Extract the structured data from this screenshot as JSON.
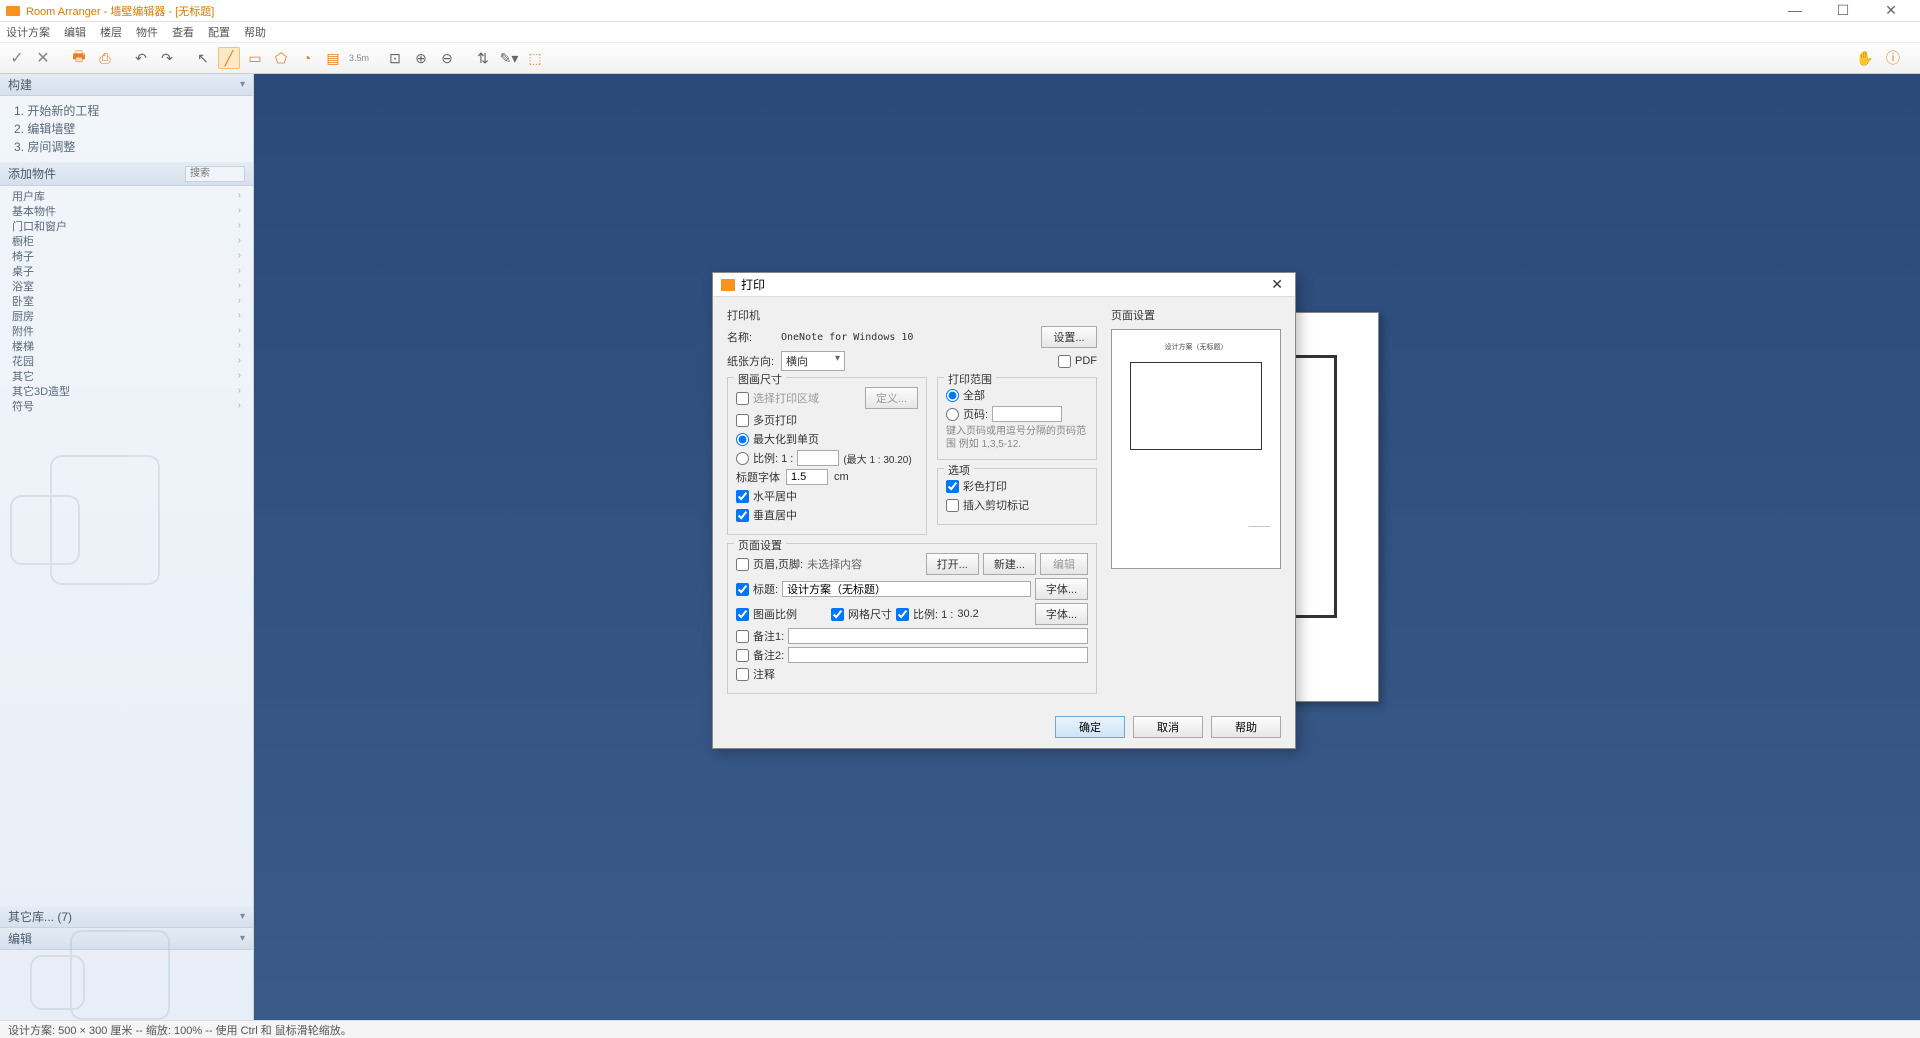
{
  "titlebar": {
    "text": "Room Arranger - 墙壁编辑器 - [无标题]"
  },
  "menubar": [
    "设计方案",
    "编辑",
    "楼层",
    "物件",
    "查看",
    "配置",
    "帮助"
  ],
  "sidebar": {
    "build_header": "构建",
    "build_items": [
      "1.  开始新的工程",
      "2.  编辑墙壁",
      "3.  房间调整"
    ],
    "addobj_header": "添加物件",
    "search_placeholder": "搜索",
    "categories": [
      "用户库",
      "基本物件",
      "门口和窗户",
      "橱柜",
      "椅子",
      "桌子",
      "浴室",
      "卧室",
      "厨房",
      "附件",
      "楼梯",
      "花园",
      "其它",
      "其它3D造型",
      "符号"
    ],
    "other_lib": "其它库...   (7)",
    "edit_header": "编辑"
  },
  "dialog": {
    "title": "打印",
    "printer_section": "打印机",
    "name_label": "名称:",
    "name_value": "OneNote for Windows 10",
    "settings_btn": "设置...",
    "orientation_label": "纸张方向:",
    "orientation_value": "横向",
    "pdf_label": "PDF",
    "drawing_size": "图画尺寸",
    "select_area": "选择打印区域",
    "define_btn": "定义...",
    "multipage": "多页打印",
    "maximize": "最大化到单页",
    "scale_label": "比例:  1 :",
    "scale_max": "(最大 1 : 30.20)",
    "title_font_label": "标题字体",
    "title_font_value": "1.5",
    "title_font_unit": "cm",
    "hcenter": "水平居中",
    "vcenter": "垂直居中",
    "print_range": "打印范围",
    "all_pages": "全部",
    "page_num": "页码:",
    "page_hint": "键入页码或用逗号分隔的页码范围 例如 1,3,5-12.",
    "options": "选项",
    "color_print": "彩色打印",
    "crop_marks": "插入剪切标记",
    "page_setup": "页面设置",
    "header_footer": "页眉,页脚:",
    "not_selected": "未选择内容",
    "open_btn": "打开...",
    "new_btn": "新建...",
    "edit_btn": "编辑",
    "title_cb": "标题:",
    "title_value": "设计方案（无标题）",
    "font_btn": "字体...",
    "drawing_scale": "图画比例",
    "grid_size": "网格尺寸",
    "scale2_label": "比例:  1 :",
    "scale2_value": "30.2",
    "font2_btn": "字体...",
    "note1": "备注1:",
    "note2": "备注2:",
    "annotation": "注释",
    "page_preview": "页面设置",
    "preview_title": "设计方案（无标题）",
    "ok": "确定",
    "cancel": "取消",
    "help": "帮助"
  },
  "statusbar": "设计方案: 500 × 300 厘米 -- 缩放: 100% -- 使用 Ctrl 和 鼠标滑轮缩放。"
}
